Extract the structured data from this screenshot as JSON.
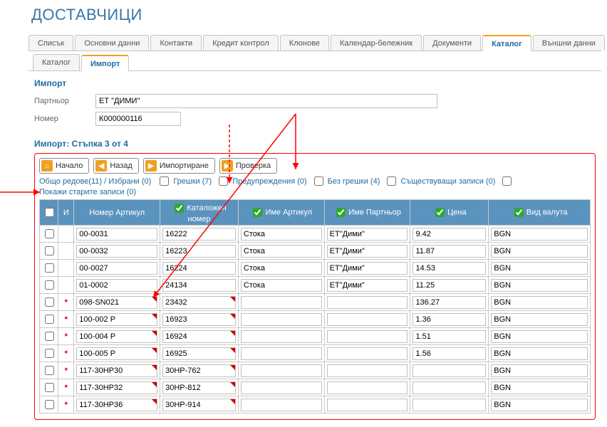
{
  "title": "ДОСТАВЧИЦИ",
  "tabs": {
    "list": [
      {
        "label": "Списък"
      },
      {
        "label": "Основни данни"
      },
      {
        "label": "Контакти"
      },
      {
        "label": "Кредит контрол"
      },
      {
        "label": "Клонове"
      },
      {
        "label": "Календар-бележник"
      },
      {
        "label": "Документи"
      },
      {
        "label": "Каталог",
        "active": true
      },
      {
        "label": "Външни данни"
      }
    ]
  },
  "subtabs": {
    "list": [
      {
        "label": "Каталог"
      },
      {
        "label": "Импорт",
        "active": true
      }
    ]
  },
  "form": {
    "section_title": "Импорт",
    "partner_label": "Партньор",
    "partner_value": "ЕТ \"ДИМИ\"",
    "number_label": "Номер",
    "number_value": "К000000116"
  },
  "step_title": "Импорт: Стъпка 3 от 4",
  "toolbar": {
    "home": "Начало",
    "back": "Назад",
    "import": "Импортиране",
    "check": "Проверка"
  },
  "filter": {
    "summary": "Общо редове(11) / Избрани (0)",
    "errors": "Грешки (7)",
    "warnings": "Предупреждения (0)",
    "noerrors": "Без грешки (4)",
    "existing": "Съществуващи записи (0)",
    "showold": "Покажи старите записи (0)"
  },
  "grid": {
    "headers": {
      "flag": "И",
      "article_no": "Номер Артикул",
      "catalog_no": "Каталожен номер",
      "article_name": "Име Артикул",
      "partner_name": "Име Партньор",
      "price": "Цена",
      "currency": "Вид валута"
    },
    "rows": [
      {
        "flag": "",
        "article_no": "00-0031",
        "catalog_no": "16222",
        "article_name": "Стока",
        "partner_name": "ЕТ\"Дими\"",
        "price": "9.42",
        "currency": "BGN",
        "mark": false
      },
      {
        "flag": "",
        "article_no": "00-0032",
        "catalog_no": "16223",
        "article_name": "Стока",
        "partner_name": "ЕТ\"Дими\"",
        "price": "11.87",
        "currency": "BGN",
        "mark": false
      },
      {
        "flag": "",
        "article_no": "00-0027",
        "catalog_no": "16224",
        "article_name": "Стока",
        "partner_name": "ЕТ\"Дими\"",
        "price": "14.53",
        "currency": "BGN",
        "mark": false
      },
      {
        "flag": "",
        "article_no": "01-0002",
        "catalog_no": "24134",
        "article_name": "Стока",
        "partner_name": "ЕТ\"Дими\"",
        "price": "11.25",
        "currency": "BGN",
        "mark": false
      },
      {
        "flag": "*",
        "article_no": "098-SN021",
        "catalog_no": "23432",
        "article_name": "",
        "partner_name": "",
        "price": "136.27",
        "currency": "BGN",
        "mark": true
      },
      {
        "flag": "*",
        "article_no": "100-002 P",
        "catalog_no": "16923",
        "article_name": "",
        "partner_name": "",
        "price": "1.36",
        "currency": "BGN",
        "mark": true
      },
      {
        "flag": "*",
        "article_no": "100-004 P",
        "catalog_no": "16924",
        "article_name": "",
        "partner_name": "",
        "price": "1.51",
        "currency": "BGN",
        "mark": true
      },
      {
        "flag": "*",
        "article_no": "100-005 P",
        "catalog_no": "16925",
        "article_name": "",
        "partner_name": "",
        "price": "1.56",
        "currency": "BGN",
        "mark": true
      },
      {
        "flag": "*",
        "article_no": "117-30HP30",
        "catalog_no": "30HP-762",
        "article_name": "",
        "partner_name": "",
        "price": "",
        "currency": "BGN",
        "mark": true
      },
      {
        "flag": "*",
        "article_no": "117-30HP32",
        "catalog_no": "30HP-812",
        "article_name": "",
        "partner_name": "",
        "price": "",
        "currency": "BGN",
        "mark": true
      },
      {
        "flag": "*",
        "article_no": "117-30HP36",
        "catalog_no": "30HP-914",
        "article_name": "",
        "partner_name": "",
        "price": "",
        "currency": "BGN",
        "mark": true
      }
    ]
  }
}
